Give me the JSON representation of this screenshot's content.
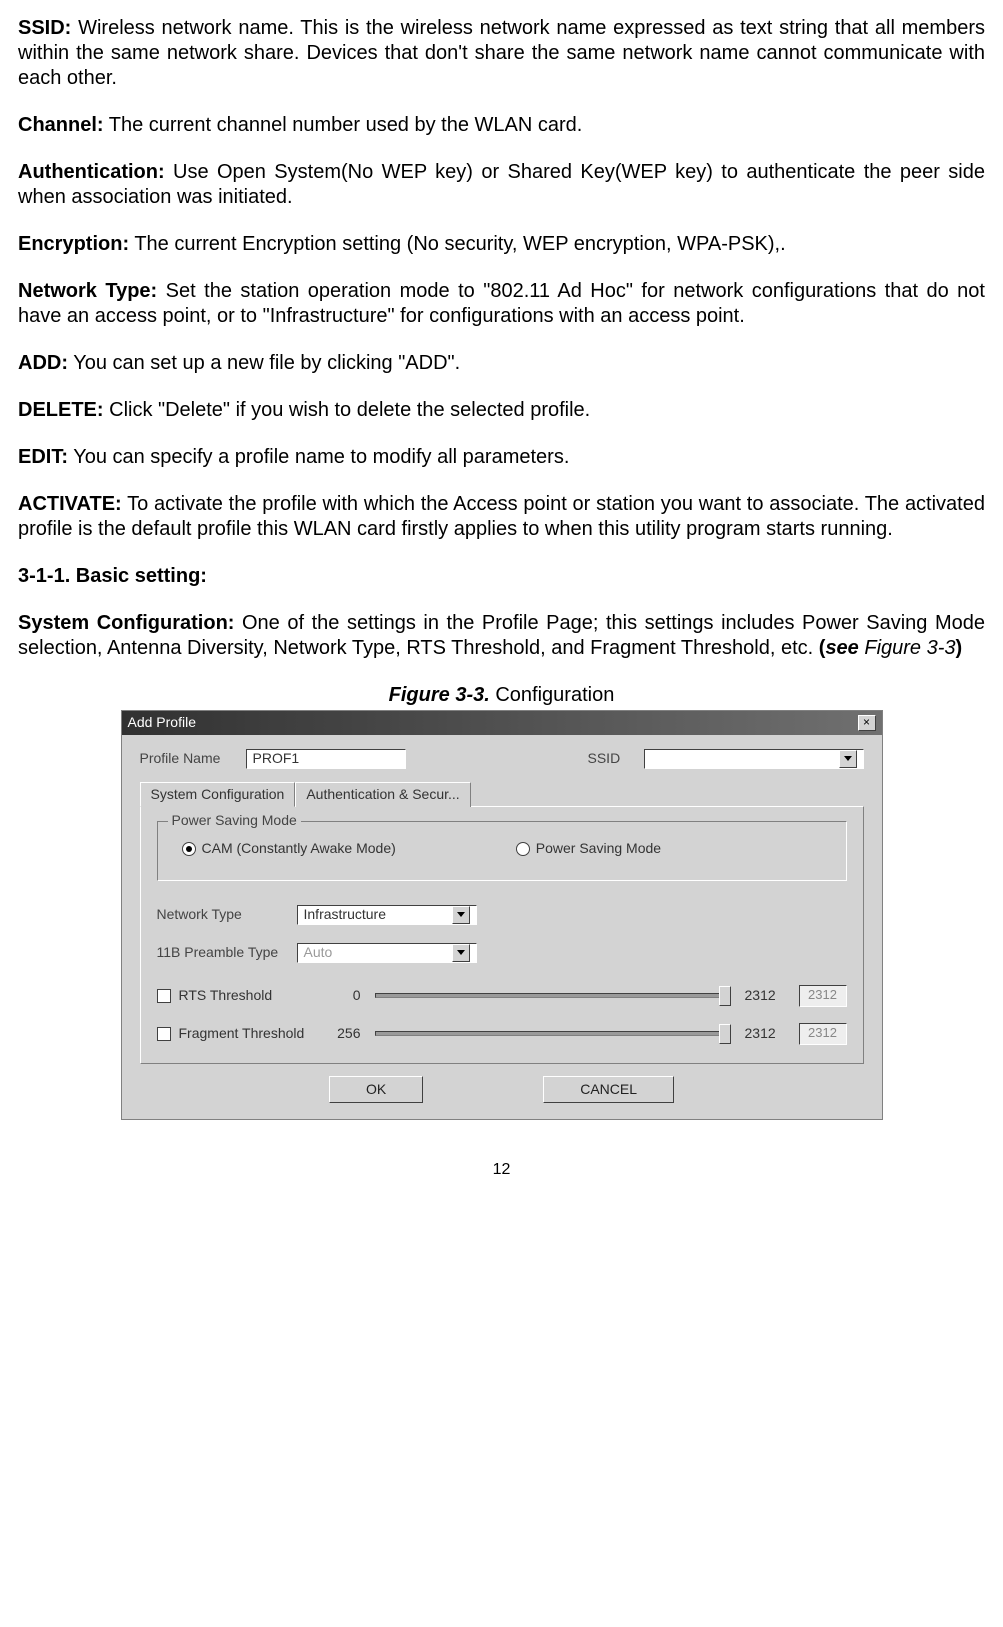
{
  "defs": {
    "ssid": {
      "term": "SSID:",
      "text": " Wireless network name. This is the wireless network name expressed as text string that all members within the same network share. Devices that don't share the same network name cannot communicate with each other."
    },
    "channel": {
      "term": "Channel:",
      "text": " The current channel number used by the WLAN card."
    },
    "auth": {
      "term": "Authentication:",
      "text": " Use Open System(No WEP key) or Shared Key(WEP key) to authenticate the peer side when association was initiated."
    },
    "encrypt": {
      "term": "Encryption:",
      "text": " The current Encryption setting (No security, WEP encryption, WPA-PSK),."
    },
    "nettype": {
      "term": "Network Type:",
      "text": " Set the station operation mode to \"802.11 Ad Hoc\" for network configurations that do not have an access point, or to \"Infrastructure\" for configurations with an access point."
    },
    "add": {
      "term": "ADD:",
      "text": " You can set up a new file by clicking \"ADD\"."
    },
    "delete": {
      "term": "DELETE:",
      "text": " Click \"Delete\" if you wish to delete the selected profile."
    },
    "edit": {
      "term": "EDIT:",
      "text": " You can specify a profile name to modify all parameters."
    },
    "activate": {
      "term": "ACTIVATE:",
      "text": " To activate the profile with which the Access point or station you want to associate. The activated profile is the default profile this WLAN card firstly applies to when this utility program starts running."
    }
  },
  "section_heading": "3-1-1. Basic setting:",
  "sysconf": {
    "term": "System Configuration:",
    "text_a": " One of the settings in the Profile Page; this settings includes Power Saving Mode selection, Antenna Diversity, Network Type, RTS Threshold, and Fragment Threshold, etc. ",
    "see_open": "(",
    "see_word": "see",
    "see_ref": " Figure 3-3",
    "see_close": ")"
  },
  "figcap": {
    "bold": "Figure 3-3.",
    "rest": "   Configuration"
  },
  "dialog": {
    "title": "Add Profile",
    "profile_name_label": "Profile Name",
    "profile_name_value": "PROF1",
    "ssid_label": "SSID",
    "ssid_value": "",
    "tabs": {
      "sysconf": "System Configuration",
      "authsec": "Authentication & Secur..."
    },
    "group_power": "Power Saving Mode",
    "radio_cam": "CAM (Constantly Awake Mode)",
    "radio_psm": "Power Saving Mode",
    "nettype_label": "Network Type",
    "nettype_value": "Infrastructure",
    "preamble_label": "11B Preamble Type",
    "preamble_value": "Auto",
    "rts_label": "RTS Threshold",
    "rts_min": "0",
    "rts_max": "2312",
    "rts_value": "2312",
    "frag_label": "Fragment Threshold",
    "frag_min": "256",
    "frag_max": "2312",
    "frag_value": "2312",
    "ok": "OK",
    "cancel": "CANCEL"
  },
  "page_number": "12"
}
